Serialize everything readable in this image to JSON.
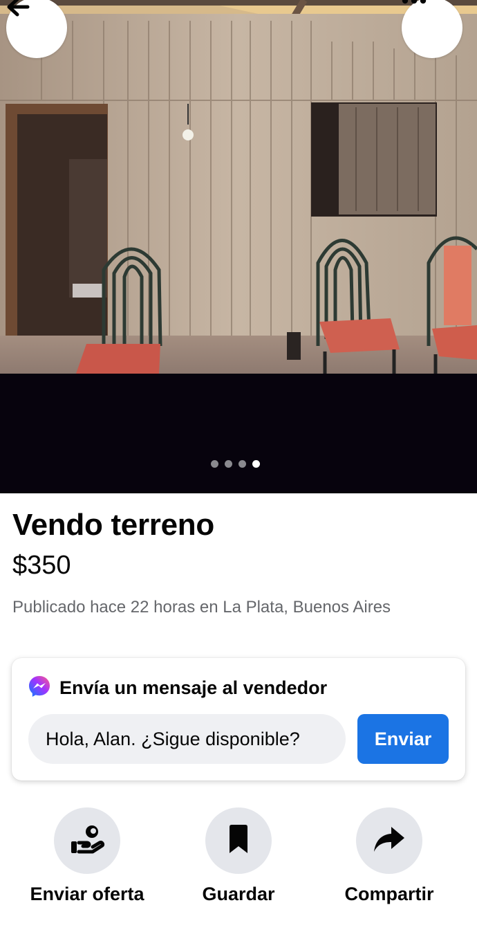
{
  "header": {
    "back_icon": "arrow-left-icon",
    "more_icon": "more-horizontal-icon"
  },
  "gallery": {
    "photo_count": 4,
    "active_index": 3
  },
  "listing": {
    "title": "Vendo terreno",
    "price": "$350",
    "posted": "Publicado hace 22 horas en La Plata, Buenos Aires"
  },
  "message": {
    "heading": "Envía un mensaje al vendedor",
    "input_value": "Hola, Alan. ¿Sigue disponible?",
    "send_label": "Enviar",
    "messenger_icon": "messenger-icon"
  },
  "actions": [
    {
      "label": "Enviar oferta",
      "icon": "hand-coin-icon"
    },
    {
      "label": "Guardar",
      "icon": "bookmark-icon"
    },
    {
      "label": "Compartir",
      "icon": "share-arrow-icon"
    }
  ],
  "colors": {
    "accent": "#1b74e4",
    "text": "#050505",
    "secondary_text": "#65676b",
    "photo_background": "#07030d"
  }
}
